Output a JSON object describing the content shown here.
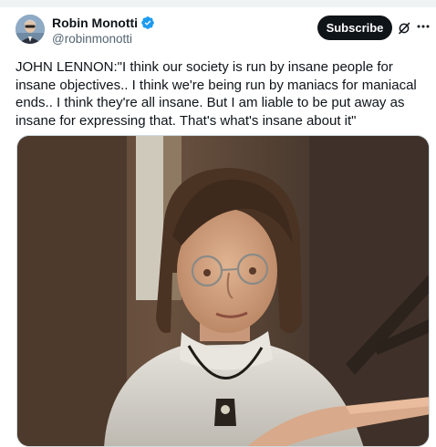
{
  "author": {
    "name": "Robin Monotti",
    "handle": "@robinmonotti",
    "verified": true,
    "verified_color": "#1d9bf0"
  },
  "actions": {
    "subscribe_label": "Subscribe",
    "grok_icon": "grok-icon",
    "more_icon": "more-icon"
  },
  "tweet": {
    "text": "JOHN LENNON:\"I think our society is run by insane people for insane objectives.. I think we're being run by maniacs for maniacal ends.. I think they're all insane. But I am liable to be put away as insane for expressing that. That's what's insane about it\""
  },
  "media": {
    "type": "video-still",
    "subject": "john-lennon-interview"
  },
  "colors": {
    "text": "#0f1419",
    "secondary": "#536471",
    "button": "#0f1419",
    "border": "#cfd9de"
  }
}
